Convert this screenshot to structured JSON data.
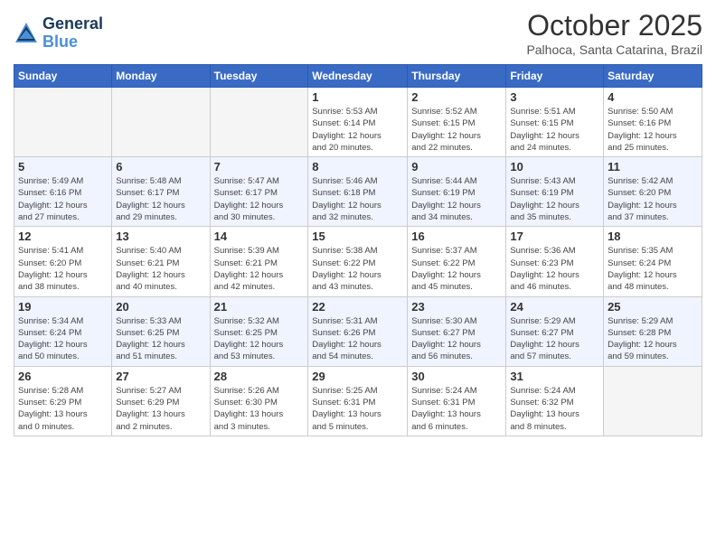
{
  "logo": {
    "line1": "General",
    "line2": "Blue"
  },
  "header": {
    "month": "October 2025",
    "location": "Palhoca, Santa Catarina, Brazil"
  },
  "weekdays": [
    "Sunday",
    "Monday",
    "Tuesday",
    "Wednesday",
    "Thursday",
    "Friday",
    "Saturday"
  ],
  "weeks": [
    [
      {
        "day": "",
        "info": ""
      },
      {
        "day": "",
        "info": ""
      },
      {
        "day": "",
        "info": ""
      },
      {
        "day": "1",
        "info": "Sunrise: 5:53 AM\nSunset: 6:14 PM\nDaylight: 12 hours\nand 20 minutes."
      },
      {
        "day": "2",
        "info": "Sunrise: 5:52 AM\nSunset: 6:15 PM\nDaylight: 12 hours\nand 22 minutes."
      },
      {
        "day": "3",
        "info": "Sunrise: 5:51 AM\nSunset: 6:15 PM\nDaylight: 12 hours\nand 24 minutes."
      },
      {
        "day": "4",
        "info": "Sunrise: 5:50 AM\nSunset: 6:16 PM\nDaylight: 12 hours\nand 25 minutes."
      }
    ],
    [
      {
        "day": "5",
        "info": "Sunrise: 5:49 AM\nSunset: 6:16 PM\nDaylight: 12 hours\nand 27 minutes."
      },
      {
        "day": "6",
        "info": "Sunrise: 5:48 AM\nSunset: 6:17 PM\nDaylight: 12 hours\nand 29 minutes."
      },
      {
        "day": "7",
        "info": "Sunrise: 5:47 AM\nSunset: 6:17 PM\nDaylight: 12 hours\nand 30 minutes."
      },
      {
        "day": "8",
        "info": "Sunrise: 5:46 AM\nSunset: 6:18 PM\nDaylight: 12 hours\nand 32 minutes."
      },
      {
        "day": "9",
        "info": "Sunrise: 5:44 AM\nSunset: 6:19 PM\nDaylight: 12 hours\nand 34 minutes."
      },
      {
        "day": "10",
        "info": "Sunrise: 5:43 AM\nSunset: 6:19 PM\nDaylight: 12 hours\nand 35 minutes."
      },
      {
        "day": "11",
        "info": "Sunrise: 5:42 AM\nSunset: 6:20 PM\nDaylight: 12 hours\nand 37 minutes."
      }
    ],
    [
      {
        "day": "12",
        "info": "Sunrise: 5:41 AM\nSunset: 6:20 PM\nDaylight: 12 hours\nand 38 minutes."
      },
      {
        "day": "13",
        "info": "Sunrise: 5:40 AM\nSunset: 6:21 PM\nDaylight: 12 hours\nand 40 minutes."
      },
      {
        "day": "14",
        "info": "Sunrise: 5:39 AM\nSunset: 6:21 PM\nDaylight: 12 hours\nand 42 minutes."
      },
      {
        "day": "15",
        "info": "Sunrise: 5:38 AM\nSunset: 6:22 PM\nDaylight: 12 hours\nand 43 minutes."
      },
      {
        "day": "16",
        "info": "Sunrise: 5:37 AM\nSunset: 6:22 PM\nDaylight: 12 hours\nand 45 minutes."
      },
      {
        "day": "17",
        "info": "Sunrise: 5:36 AM\nSunset: 6:23 PM\nDaylight: 12 hours\nand 46 minutes."
      },
      {
        "day": "18",
        "info": "Sunrise: 5:35 AM\nSunset: 6:24 PM\nDaylight: 12 hours\nand 48 minutes."
      }
    ],
    [
      {
        "day": "19",
        "info": "Sunrise: 5:34 AM\nSunset: 6:24 PM\nDaylight: 12 hours\nand 50 minutes."
      },
      {
        "day": "20",
        "info": "Sunrise: 5:33 AM\nSunset: 6:25 PM\nDaylight: 12 hours\nand 51 minutes."
      },
      {
        "day": "21",
        "info": "Sunrise: 5:32 AM\nSunset: 6:25 PM\nDaylight: 12 hours\nand 53 minutes."
      },
      {
        "day": "22",
        "info": "Sunrise: 5:31 AM\nSunset: 6:26 PM\nDaylight: 12 hours\nand 54 minutes."
      },
      {
        "day": "23",
        "info": "Sunrise: 5:30 AM\nSunset: 6:27 PM\nDaylight: 12 hours\nand 56 minutes."
      },
      {
        "day": "24",
        "info": "Sunrise: 5:29 AM\nSunset: 6:27 PM\nDaylight: 12 hours\nand 57 minutes."
      },
      {
        "day": "25",
        "info": "Sunrise: 5:29 AM\nSunset: 6:28 PM\nDaylight: 12 hours\nand 59 minutes."
      }
    ],
    [
      {
        "day": "26",
        "info": "Sunrise: 5:28 AM\nSunset: 6:29 PM\nDaylight: 13 hours\nand 0 minutes."
      },
      {
        "day": "27",
        "info": "Sunrise: 5:27 AM\nSunset: 6:29 PM\nDaylight: 13 hours\nand 2 minutes."
      },
      {
        "day": "28",
        "info": "Sunrise: 5:26 AM\nSunset: 6:30 PM\nDaylight: 13 hours\nand 3 minutes."
      },
      {
        "day": "29",
        "info": "Sunrise: 5:25 AM\nSunset: 6:31 PM\nDaylight: 13 hours\nand 5 minutes."
      },
      {
        "day": "30",
        "info": "Sunrise: 5:24 AM\nSunset: 6:31 PM\nDaylight: 13 hours\nand 6 minutes."
      },
      {
        "day": "31",
        "info": "Sunrise: 5:24 AM\nSunset: 6:32 PM\nDaylight: 13 hours\nand 8 minutes."
      },
      {
        "day": "",
        "info": ""
      }
    ]
  ]
}
